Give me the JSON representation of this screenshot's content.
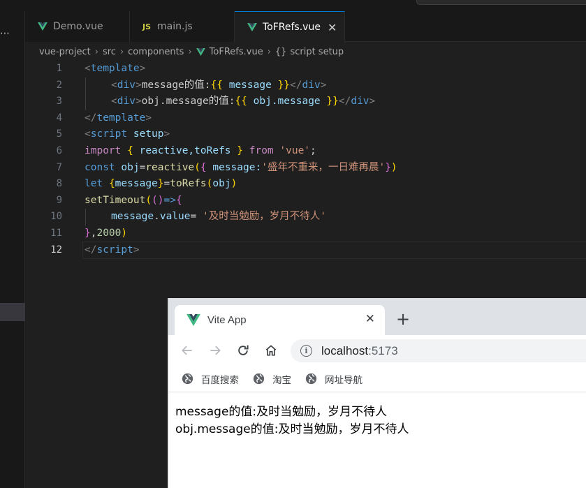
{
  "editor": {
    "tabs": [
      {
        "label": "Demo.vue",
        "icon": "vue-icon"
      },
      {
        "label": "main.js",
        "icon": "js-icon",
        "badge": "JS"
      },
      {
        "label": "ToFRefs.vue",
        "icon": "vue-icon",
        "active": true
      }
    ],
    "breadcrumb": [
      "vue-project",
      "src",
      "components",
      "ToFRefs.vue",
      "script setup"
    ],
    "braces_glyph": "{}",
    "current_line": 12,
    "lines": [
      {
        "n": "1"
      },
      {
        "n": "2"
      },
      {
        "n": "3"
      },
      {
        "n": "4"
      },
      {
        "n": "5"
      },
      {
        "n": "6"
      },
      {
        "n": "7"
      },
      {
        "n": "8"
      },
      {
        "n": "9"
      },
      {
        "n": "10"
      },
      {
        "n": "11"
      },
      {
        "n": "12"
      }
    ],
    "code": {
      "l1": [
        "<",
        "template",
        ">"
      ],
      "l2": [
        "<",
        "div",
        ">",
        "message的值:",
        "{{",
        " message ",
        "}}",
        "</",
        "div",
        ">"
      ],
      "l3": [
        "<",
        "div",
        ">",
        "obj.message的值:",
        "{{",
        " obj.message ",
        "}}",
        "</",
        "div",
        ">"
      ],
      "l4": [
        "</",
        "template",
        ">"
      ],
      "l5": [
        "<",
        "script",
        " ",
        "setup",
        ">"
      ],
      "l6": [
        "import",
        " ",
        "{",
        " reactive,toRefs ",
        "}",
        " ",
        "from",
        " ",
        "'vue'",
        ";"
      ],
      "l7": [
        "const",
        " ",
        "obj",
        "=",
        "reactive",
        "(",
        "{",
        " message:",
        "'盛年不重来，一日难再晨'",
        "}",
        ")"
      ],
      "l8": [
        "let",
        " ",
        "{",
        "message",
        "}",
        "=",
        "toRefs",
        "(",
        "obj",
        ")"
      ],
      "l9": [
        "setTimeout",
        "(",
        "()",
        "=>",
        "{"
      ],
      "l10": [
        "message",
        ".",
        "value",
        "= ",
        "'及时当勉励，岁月不待人'"
      ],
      "l11": [
        "}",
        ",",
        "2000",
        ")"
      ],
      "l12": [
        "</",
        "script",
        ">"
      ]
    }
  },
  "browser": {
    "tab_title": "Vite App",
    "url_host": "localhost",
    "url_port": ":5173",
    "bookmarks": [
      "百度搜索",
      "淘宝",
      "网址导航"
    ],
    "content": [
      "message的值:及时当勉励，岁月不待人",
      "obj.message的值:及时当勉励，岁月不待人"
    ]
  },
  "colors": {
    "vue_green": "#41b883",
    "editor_bg": "#1f1f1f",
    "accent": "#0078d4"
  }
}
